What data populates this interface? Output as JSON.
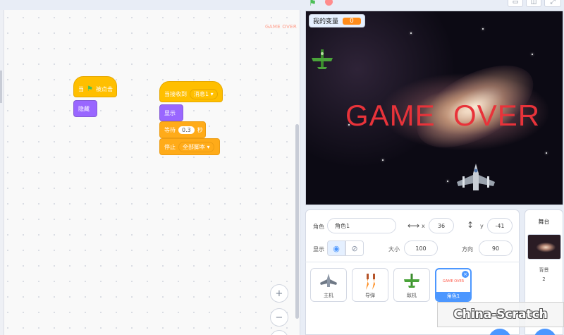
{
  "script_area": {
    "sprite_watermark": "GAME OVER",
    "blocks": {
      "when_flag_clicked_prefix": "当",
      "when_flag_clicked_suffix": "被点击",
      "hide": "隐藏",
      "when_receive": "当接收到",
      "message": "消息1",
      "show": "显示",
      "wait_prefix": "等待",
      "wait_value": "0.3",
      "wait_suffix": "秒",
      "stop": "停止",
      "stop_option": "全部脚本"
    },
    "zoom_in": "+",
    "zoom_out": "−"
  },
  "stage": {
    "variable_name": "我的变量",
    "variable_value": "0",
    "game_over_text": "GAME  OVER"
  },
  "sprite_info": {
    "sprite_label": "角色",
    "sprite_name": "角色1",
    "x_label": "x",
    "x_value": "36",
    "y_label": "y",
    "y_value": "-41",
    "show_label": "显示",
    "size_label": "大小",
    "size_value": "100",
    "direction_label": "方向",
    "direction_value": "90"
  },
  "sprites": [
    {
      "name": "主机",
      "icon": "jet-icon"
    },
    {
      "name": "导弹",
      "icon": "missile-icon"
    },
    {
      "name": "敌机",
      "icon": "enemy-plane-icon"
    },
    {
      "name": "角色1",
      "icon": "game-over-thumb",
      "thumb_text": "GAME OVER"
    }
  ],
  "stage_pane": {
    "title": "舞台",
    "backdrop_label": "背景",
    "backdrop_count": "2"
  },
  "watermark": "China-Scratch",
  "colors": {
    "events": "#ffbf00",
    "looks": "#9966ff",
    "control": "#ffab19",
    "accent": "#4c97ff",
    "game_over": "#e8333a"
  }
}
